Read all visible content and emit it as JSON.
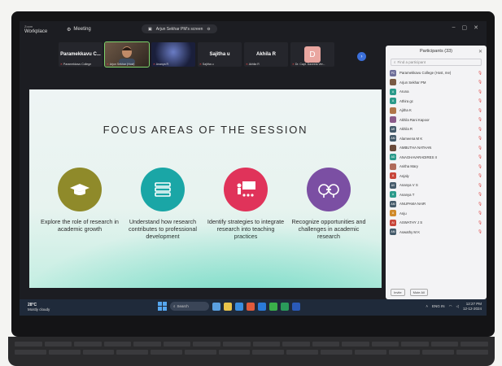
{
  "app": {
    "brand_small": "Zoom",
    "brand": "Workplace",
    "meeting_label": "Meeting",
    "sharing_text": "Arjun Sekhar PM's screen"
  },
  "strip": {
    "tiles": [
      {
        "name": "Paramekkavu C...",
        "caption": "Paramekkavu College"
      },
      {
        "name": "",
        "caption": "Arjun Sekhar (Host)"
      },
      {
        "name": "",
        "caption": "Ananya R"
      },
      {
        "name": "Sajitha u",
        "caption": "Sajitha u"
      },
      {
        "name": "Akhila R",
        "caption": "Akhila R"
      },
      {
        "name": "D",
        "caption": "Dr. Capt. Daveela Ver..."
      }
    ]
  },
  "slide": {
    "title": "FOCUS AREAS OF THE SESSION",
    "areas": [
      {
        "text": "Explore the role of research in academic growth",
        "color": "#8f8a2a",
        "icon": "graduation-cap-icon"
      },
      {
        "text": "Understand how research contributes to professional development",
        "color": "#1aa6a6",
        "icon": "books-icon"
      },
      {
        "text": "Identify strategies to integrate research into teaching practices",
        "color": "#e0335a",
        "icon": "teacher-board-icon"
      },
      {
        "text": "Recognize opportunities and challenges in academic research",
        "color": "#7b4fa3",
        "icon": "handshake-icon"
      }
    ]
  },
  "panel": {
    "title": "Participants (33)",
    "search_placeholder": "Find a participant",
    "participants": [
      {
        "initials": "PC",
        "name": "Paramekkavu College (Host, me)",
        "color": "#6f6f9a"
      },
      {
        "initials": "",
        "name": "Arjun Sekhar PM",
        "color": "#7a5a44"
      },
      {
        "initials": "A",
        "name": "Aruna",
        "color": "#2b9a8a"
      },
      {
        "initials": "A",
        "name": "Athira gc",
        "color": "#2b9a8a"
      },
      {
        "initials": "",
        "name": "Ajitha K",
        "color": "#b0764a"
      },
      {
        "initials": "",
        "name": "Akhila Rani Kapoor",
        "color": "#8a5a8a"
      },
      {
        "initials": "AR",
        "name": "Akhila R",
        "color": "#445a6a"
      },
      {
        "initials": "AM",
        "name": "Alameena M K",
        "color": "#445a6a"
      },
      {
        "initials": "",
        "name": "AMBUTHA NATHAN",
        "color": "#6a4a3a"
      },
      {
        "initials": "AD",
        "name": "ANAGHAVARADIRES II",
        "color": "#2b9a8a"
      },
      {
        "initials": "",
        "name": "Anitha Mary",
        "color": "#b06a5a"
      },
      {
        "initials": "A",
        "name": "Anjaly",
        "color": "#c8463a"
      },
      {
        "initials": "AV",
        "name": "Ananya V S",
        "color": "#445a6a"
      },
      {
        "initials": "A",
        "name": "Ananya T",
        "color": "#2b9a8a"
      },
      {
        "initials": "AM",
        "name": "ANUPAMA NAIR",
        "color": "#445a6a"
      },
      {
        "initials": "A",
        "name": "Anju",
        "color": "#d08a2a"
      },
      {
        "initials": "AI",
        "name": "ASWATHY J S",
        "color": "#c8463a"
      },
      {
        "initials": "AM",
        "name": "Aswathy M K",
        "color": "#445a6a"
      }
    ],
    "invite_label": "Invite",
    "mute_all_label": "Mute All"
  },
  "taskbar": {
    "temp": "28°C",
    "weather": "Mostly cloudy",
    "search_label": "Search",
    "time": "12:27 PM",
    "date": "12-12-2024",
    "lang": "ENG IN"
  }
}
